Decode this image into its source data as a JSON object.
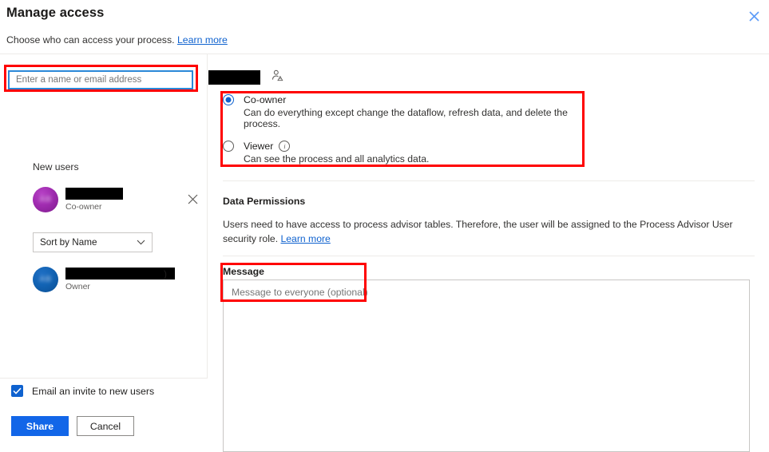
{
  "header": {
    "title": "Manage access",
    "subtitle_text": "Choose who can access your process.",
    "subtitle_link": "Learn more",
    "close_icon": "close-icon"
  },
  "left_panel": {
    "search": {
      "placeholder": "Enter a name or email address",
      "value": ""
    },
    "new_users_label": "New users",
    "new_user": {
      "name_redacted": "",
      "role": "Co-owner",
      "avatar_color": "#a02bb0",
      "remove_icon": "close-icon"
    },
    "sort": {
      "selected": "Sort by Name",
      "caret_icon": "chevron-down-icon"
    },
    "existing_user": {
      "name_redacted": ")",
      "role": "Owner",
      "avatar_color": "#1263b4"
    },
    "email_invite": {
      "label": "Email an invite to new users",
      "checked": true
    },
    "buttons": {
      "primary": "Share",
      "secondary": "Cancel"
    }
  },
  "right_panel": {
    "target_name_redacted": "",
    "target_icon": "person-warning-icon",
    "permissions": [
      {
        "label": "Co-owner",
        "description": "Can do everything except change the dataflow, refresh data, and delete the process.",
        "selected": true,
        "has_info": false
      },
      {
        "label": "Viewer",
        "description": "Can see the process and all analytics data.",
        "selected": false,
        "has_info": true,
        "info_icon": "info-icon"
      }
    ],
    "data_permissions": {
      "title": "Data Permissions",
      "body": "Users need to have access to process advisor tables. Therefore, the user will be assigned to the Process Advisor User security role. ",
      "link": "Learn more"
    },
    "message": {
      "title": "Message",
      "placeholder": "Message to everyone (optional)",
      "value": ""
    }
  },
  "annotations": {
    "highlight_color": "#ff0000",
    "boxes": [
      "search-input",
      "permissions-group",
      "message-field"
    ]
  },
  "theme": {
    "accent": "#0f62cf",
    "primary_button": "#1266e8",
    "link": "#0f62cf",
    "border": "#c8c6c4",
    "divider": "#edebe9"
  }
}
